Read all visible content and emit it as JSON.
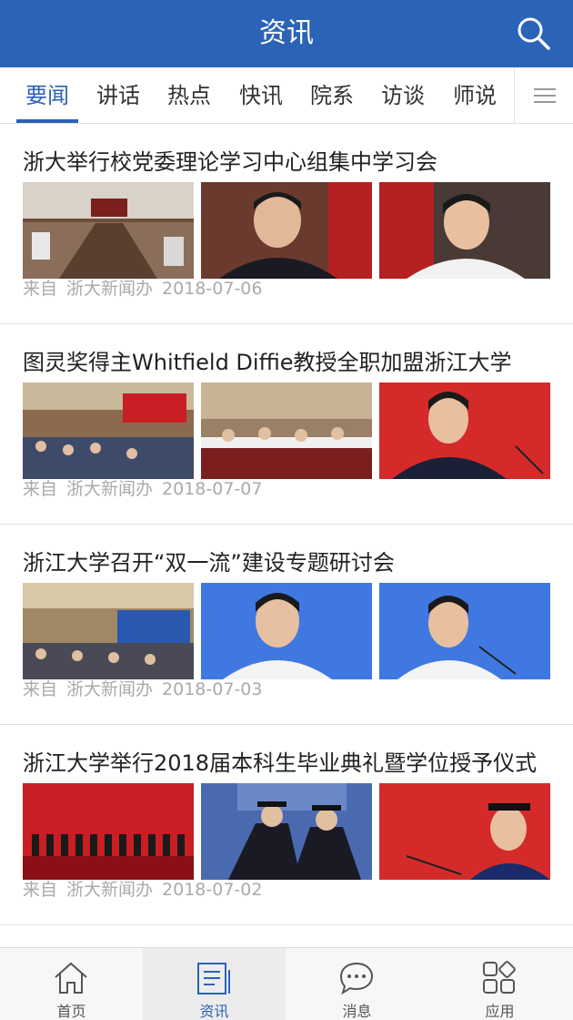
{
  "header": {
    "title": "资讯"
  },
  "tabs": [
    "要闻",
    "讲话",
    "热点",
    "快讯",
    "院系",
    "访谈",
    "师说"
  ],
  "news": [
    {
      "title": "浙大举行校党委理论学习中心组集中学习会",
      "source_label": "来自",
      "source": "浙大新闻办",
      "date": "2018-07-06"
    },
    {
      "title": "图灵奖得主Whitfield Diffie教授全职加盟浙江大学",
      "source_label": "来自",
      "source": "浙大新闻办",
      "date": "2018-07-07"
    },
    {
      "title": "浙江大学召开“双一流”建设专题研讨会",
      "source_label": "来自",
      "source": "浙大新闻办",
      "date": "2018-07-03"
    },
    {
      "title": "浙江大学举行2018届本科生毕业典礼暨学位授予仪式",
      "source_label": "来自",
      "source": "浙大新闻办",
      "date": "2018-07-02"
    }
  ],
  "bottom_nav": [
    {
      "label": "首页",
      "icon": "home-icon"
    },
    {
      "label": "资讯",
      "icon": "news-icon"
    },
    {
      "label": "消息",
      "icon": "message-icon"
    },
    {
      "label": "应用",
      "icon": "apps-icon"
    }
  ],
  "colors": {
    "brand": "#2b63b6",
    "meta": "#aaaaaa"
  }
}
